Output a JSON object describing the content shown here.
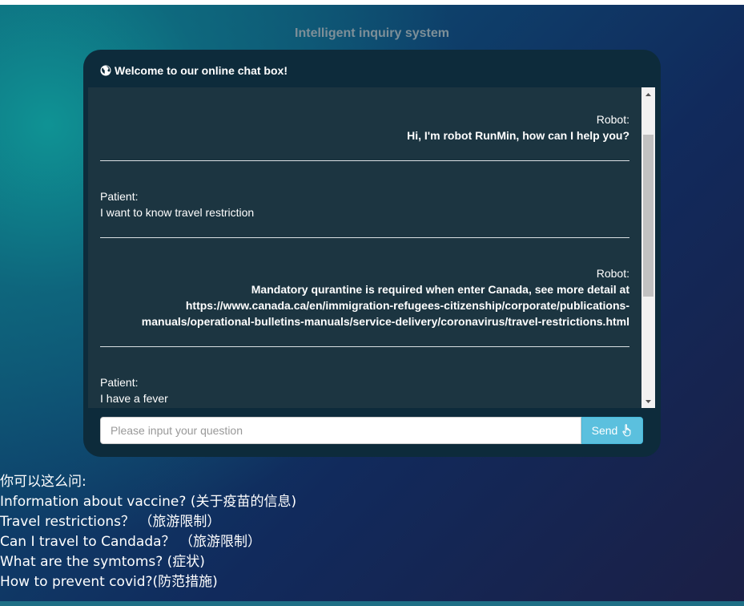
{
  "page": {
    "title": "Intelligent inquiry system"
  },
  "chat": {
    "header": "Welcome to our online chat box!",
    "header_icon": "globe-icon",
    "messages": [
      {
        "role": "robot",
        "speaker": "Robot:",
        "text": "Hi, I'm robot RunMin, how can I help you?"
      },
      {
        "role": "patient",
        "speaker": "Patient:",
        "text": "I want to know travel restriction"
      },
      {
        "role": "robot",
        "speaker": "Robot:",
        "lines": [
          "Mandatory qurantine is required when enter Canada, see more detail at",
          "https://www.canada.ca/en/immigration-refugees-citizenship/corporate/publications-",
          "manuals/operational-bulletins-manuals/service-delivery/coronavirus/travel-restrictions.html"
        ]
      },
      {
        "role": "patient",
        "speaker": "Patient:",
        "text": "I have a fever"
      }
    ],
    "input": {
      "placeholder": "Please input your question",
      "value": ""
    },
    "send_label": "Send",
    "send_icon": "hand-pointer-icon"
  },
  "suggestions": {
    "intro": "你可以这么问:",
    "items": [
      "Information about vaccine? (关于疫苗的信息)",
      "Travel restrictions？ （旅游限制）",
      "Can I travel to Candada？ （旅游限制）",
      "What are the symtoms? (症状)",
      "How to prevent covid?(防范措施)"
    ]
  },
  "colors": {
    "chat_bg": "#0d2b3b",
    "messages_bg": "#1c3541",
    "send_button": "#5bc0de",
    "title_text": "#7d8f98"
  }
}
